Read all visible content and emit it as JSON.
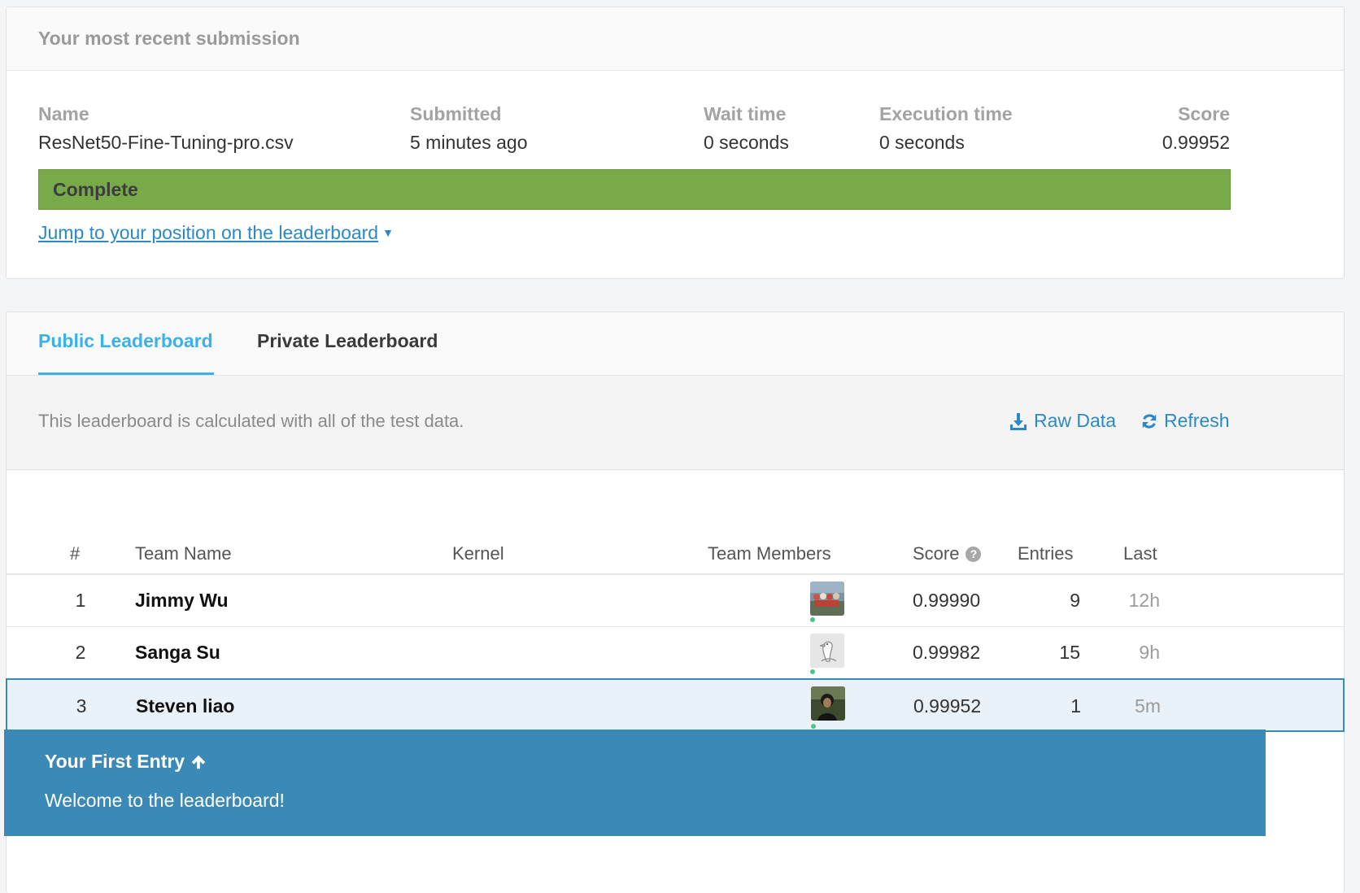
{
  "submission": {
    "header": "Your most recent submission",
    "columns": [
      {
        "label": "Name",
        "value": "ResNet50-Fine-Tuning-pro.csv"
      },
      {
        "label": "Submitted",
        "value": "5 minutes ago"
      },
      {
        "label": "Wait time",
        "value": "0 seconds"
      },
      {
        "label": "Execution time",
        "value": "0 seconds"
      },
      {
        "label": "Score",
        "value": "0.99952"
      }
    ],
    "status": "Complete",
    "jump_link": "Jump to your position on the leaderboard",
    "status_color": "#79aa4a"
  },
  "leaderboard": {
    "tabs": [
      {
        "label": "Public Leaderboard",
        "active": true
      },
      {
        "label": "Private Leaderboard",
        "active": false
      }
    ],
    "description": "This leaderboard is calculated with all of the test data.",
    "actions": {
      "raw_data": "Raw Data",
      "refresh": "Refresh"
    },
    "headers": {
      "rank": "#",
      "team": "Team Name",
      "kernel": "Kernel",
      "members": "Team Members",
      "score": "Score",
      "entries": "Entries",
      "last": "Last"
    },
    "rows": [
      {
        "rank": "1",
        "team": "Jimmy Wu",
        "score": "0.99990",
        "entries": "9",
        "last": "12h",
        "avatar": "group-photo"
      },
      {
        "rank": "2",
        "team": "Sanga Su",
        "score": "0.99982",
        "entries": "15",
        "last": "9h",
        "avatar": "goose-drawing"
      },
      {
        "rank": "3",
        "team": "Steven liao",
        "score": "0.99952",
        "entries": "1",
        "last": "5m",
        "avatar": "person-photo",
        "highlighted": true
      }
    ],
    "accent_color": "#3bb1ea",
    "link_color": "#2b8ac4"
  },
  "banner": {
    "title": "Your First Entry",
    "message": "Welcome to the leaderboard!",
    "color": "#3a89b6"
  }
}
